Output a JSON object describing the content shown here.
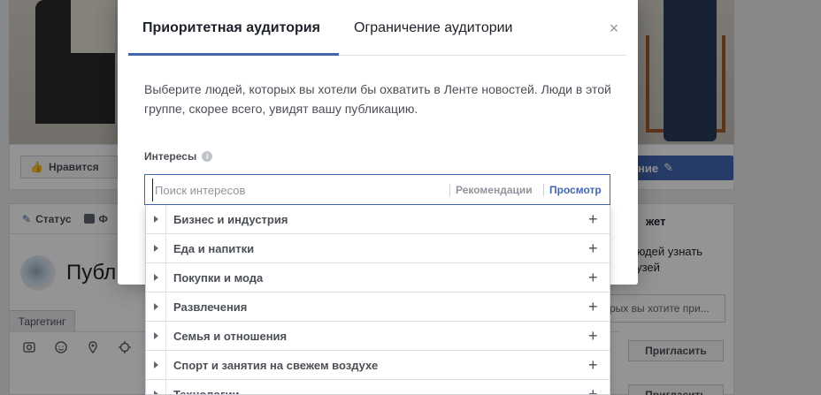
{
  "background": {
    "like_label": "Нравится",
    "edit_label": "ние",
    "status_label": "Статус",
    "photo_tab_label": "Ф",
    "composer_text": "Публ",
    "targeting_label": "Таргетинг",
    "side_header": "жет",
    "side_text_1": "людей узнать",
    "side_text_2": "рузей",
    "side_field_text": "рых вы хотите при...",
    "invite_label": "Пригласить",
    "invite_label_2": "Пригласить"
  },
  "modal": {
    "tabs": [
      {
        "label": "Приоритетная аудитория",
        "active": true
      },
      {
        "label": "Ограничение аудитории",
        "active": false
      }
    ],
    "close_symbol": "×",
    "description": "Выберите людей, которых вы хотели бы охватить в Ленте новостей. Люди в этой группе, скорее всего, увидят вашу публикацию.",
    "interests_label": "Интересы",
    "info_symbol": "i",
    "search": {
      "placeholder": "Поиск интересов",
      "value": "",
      "recommendations_label": "Рекомендации",
      "view_label": "Просмотр"
    },
    "categories": [
      {
        "label": "Бизнес и индустрия"
      },
      {
        "label": "Еда и напитки"
      },
      {
        "label": "Покупки и мода"
      },
      {
        "label": "Развлечения"
      },
      {
        "label": "Семья и отношения"
      },
      {
        "label": "Спорт и занятия на свежем воздухе"
      },
      {
        "label": "Технологии"
      }
    ],
    "plus_symbol": "+"
  },
  "colors": {
    "accent": "#4267b2",
    "overlay": "rgba(0,0,0,0.42)"
  }
}
